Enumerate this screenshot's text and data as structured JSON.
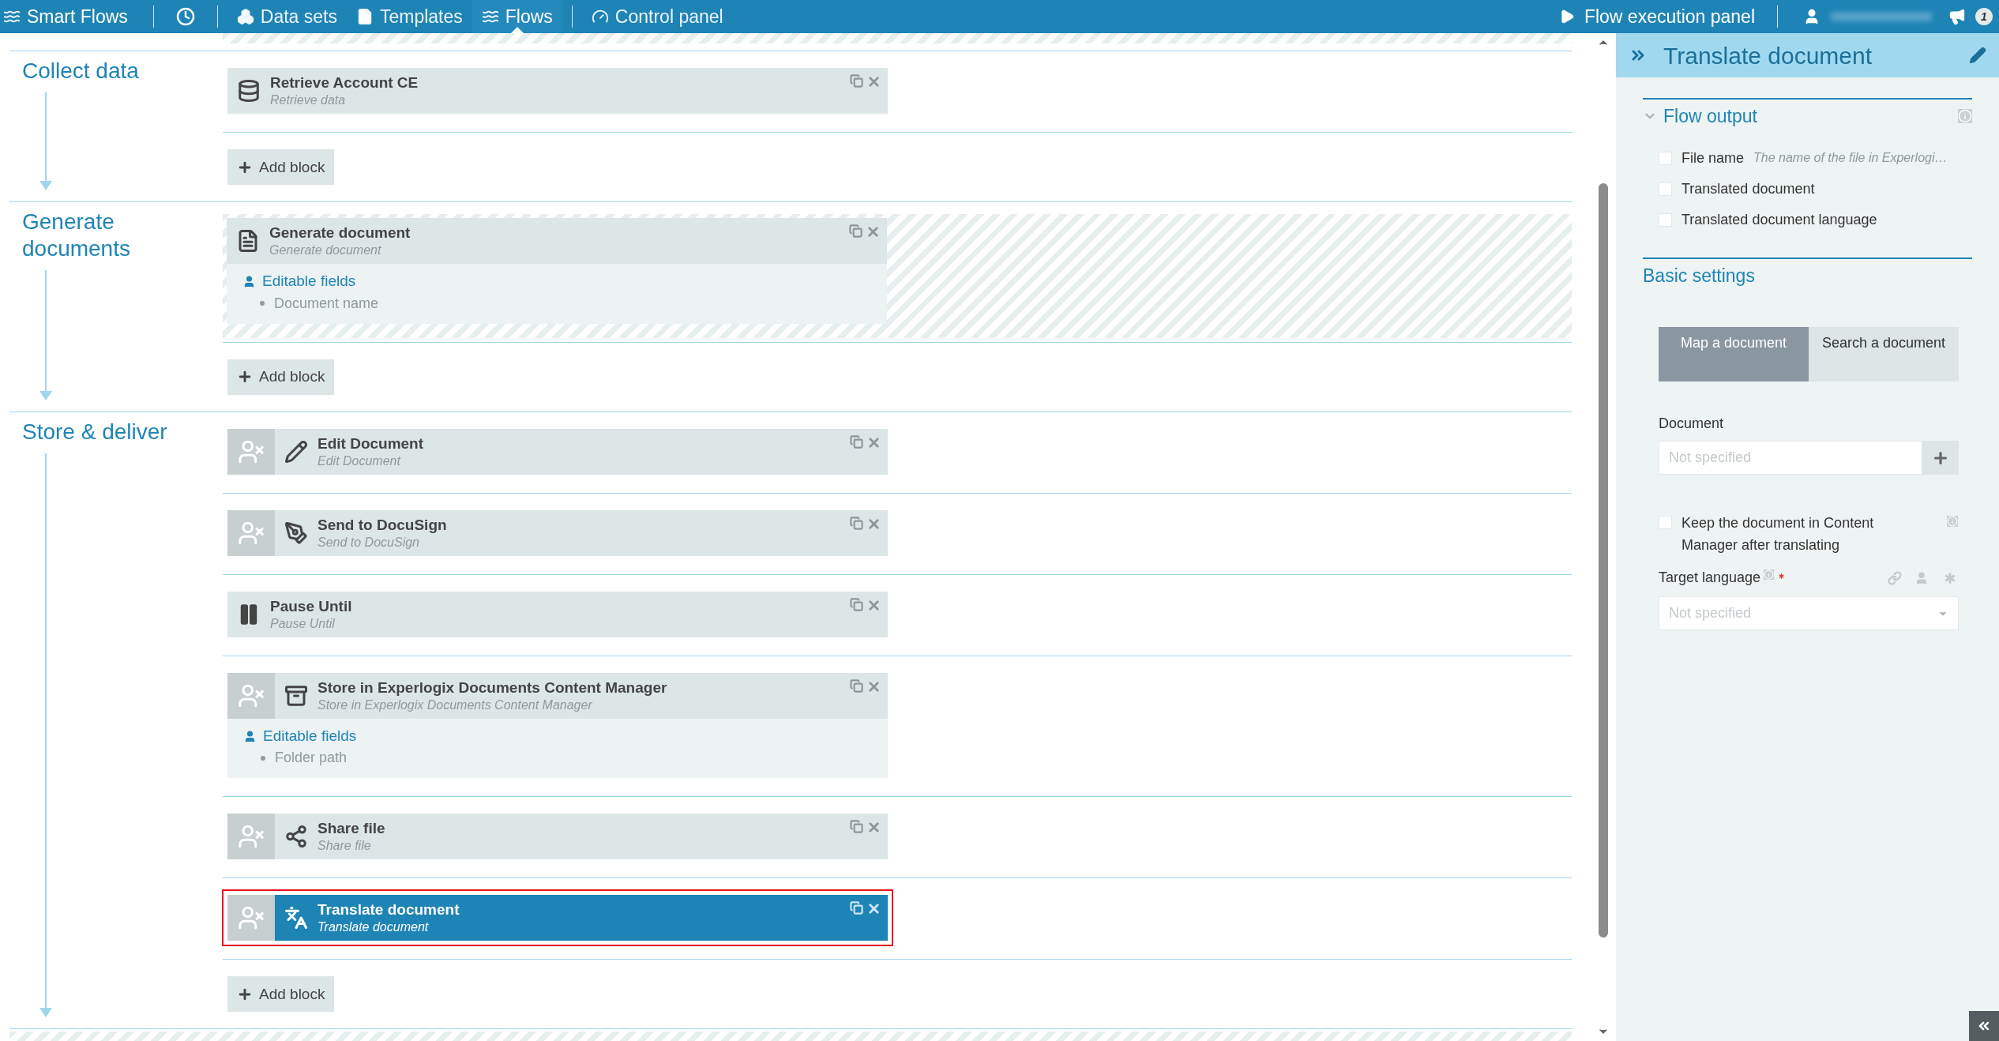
{
  "nav": {
    "brand": "Smart Flows",
    "menus": [
      {
        "items": [
          {
            "kind": "datasets",
            "label": "Data sets",
            "selected": false
          },
          {
            "kind": "templates",
            "label": "Templates",
            "selected": false
          },
          {
            "kind": "flows",
            "label": "Flows",
            "selected": true
          }
        ]
      },
      {
        "items": [
          {
            "kind": "control",
            "label": "Control panel",
            "selected": false
          }
        ]
      }
    ],
    "execution_panel": "Flow execution panel",
    "notification_count": "1"
  },
  "flow": {
    "sections": [
      {
        "title": "Collect data",
        "add_label": "Add block",
        "blocks": [
          {
            "kind": "retrieve",
            "title": "Retrieve Account CE",
            "subtitle": "Retrieve data",
            "user_task": false,
            "striped": false,
            "selected": false
          }
        ]
      },
      {
        "title": "Generate documents",
        "add_label": "Add block",
        "blocks": [
          {
            "kind": "generate",
            "title": "Generate document",
            "subtitle": "Generate document",
            "user_task": false,
            "striped": true,
            "selected": false,
            "editable_fields": {
              "label": "Editable fields",
              "items": [
                "Document name"
              ]
            }
          }
        ]
      },
      {
        "title": "Store & deliver",
        "add_label": "Add block",
        "blocks": [
          {
            "kind": "edit",
            "title": "Edit Document",
            "subtitle": "Edit Document",
            "user_task": true,
            "striped": false,
            "selected": false
          },
          {
            "kind": "sign",
            "title": "Send to DocuSign",
            "subtitle": "Send to DocuSign",
            "user_task": true,
            "striped": false,
            "selected": false
          },
          {
            "kind": "pause",
            "title": "Pause Until",
            "subtitle": "Pause Until",
            "user_task": false,
            "striped": false,
            "selected": false
          },
          {
            "kind": "store",
            "title": "Store in Experlogix Documents Content Manager",
            "subtitle": "Store in Experlogix Documents Content Manager",
            "user_task": true,
            "striped": false,
            "selected": false,
            "editable_fields": {
              "label": "Editable fields",
              "items": [
                "Folder path"
              ]
            }
          },
          {
            "kind": "share",
            "title": "Share file",
            "subtitle": "Share file",
            "user_task": true,
            "striped": false,
            "selected": false
          },
          {
            "kind": "translate",
            "title": "Translate document",
            "subtitle": "Translate document",
            "user_task": true,
            "striped": false,
            "selected": true
          }
        ]
      }
    ]
  },
  "panel": {
    "title": "Translate document",
    "flow_output": {
      "title": "Flow output",
      "expanded": true,
      "items": [
        {
          "label": "File name",
          "hint": "The name of the file in Experlogi…",
          "checked": false
        },
        {
          "label": "Translated document",
          "checked": false
        },
        {
          "label": "Translated document language",
          "checked": false
        }
      ]
    },
    "basic_settings": {
      "title": "Basic settings",
      "tabs": [
        {
          "label": "Map a document",
          "selected": true
        },
        {
          "label": "Search a document",
          "selected": false
        }
      ],
      "document": {
        "label": "Document",
        "placeholder": "Not specified"
      },
      "keep": {
        "label": "Keep the document in Content Manager after translating",
        "checked": false
      },
      "target_language": {
        "label": "Target language",
        "required": true,
        "placeholder": "Not specified"
      }
    }
  }
}
